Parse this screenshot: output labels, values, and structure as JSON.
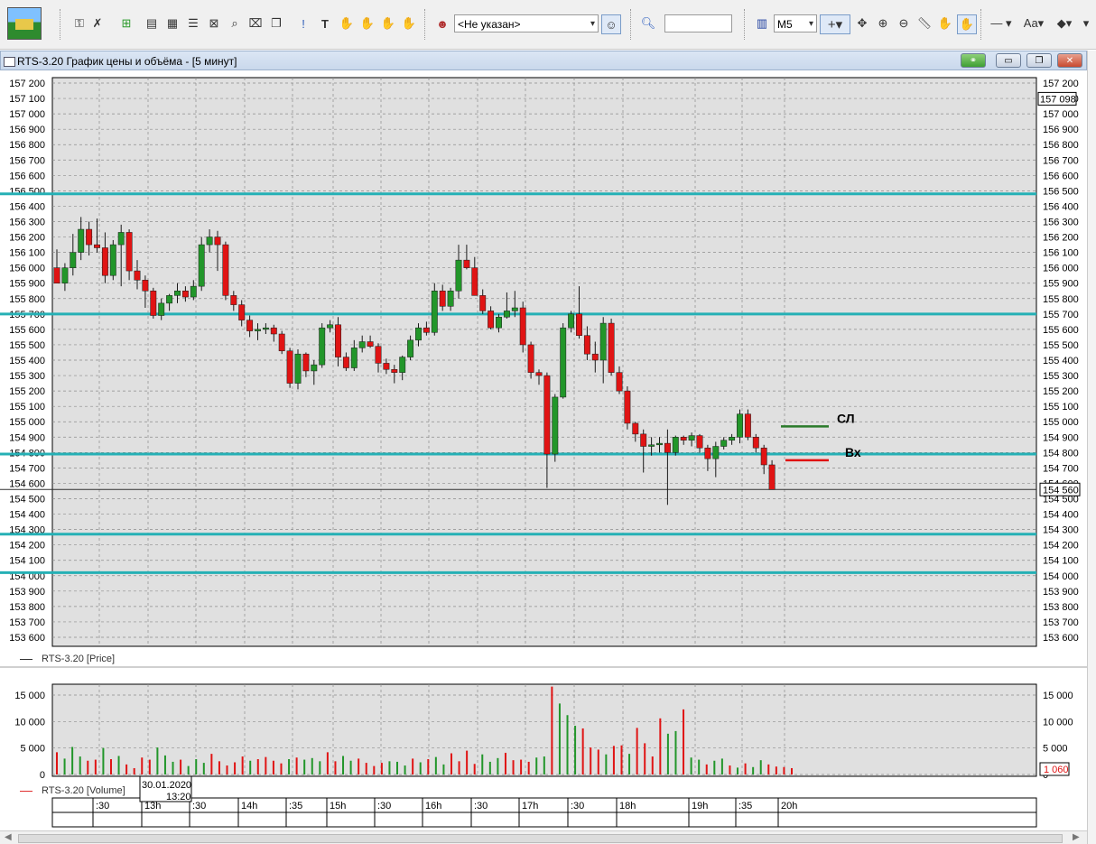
{
  "toolbar": {
    "client_select": "<Не указан>",
    "timeframe_select": "M5",
    "search_value": ""
  },
  "window": {
    "title": "RTS-3.20 График цены и объёма - [5 минут]"
  },
  "price_chart": {
    "legend": "RTS-3.20 [Price]",
    "y_ticks": [
      157200,
      157100,
      157000,
      156900,
      156800,
      156700,
      156600,
      156500,
      156400,
      156300,
      156200,
      156100,
      156000,
      155900,
      155800,
      155700,
      155600,
      155500,
      155400,
      155300,
      155200,
      155100,
      155000,
      154900,
      154800,
      154700,
      154600,
      154500,
      154400,
      154300,
      154200,
      154100,
      154000,
      153900,
      153800,
      153700,
      153600
    ],
    "y_tick_labels": [
      "157 200",
      "157 100",
      "157 000",
      "156 900",
      "156 800",
      "156 700",
      "156 600",
      "156 500",
      "156 400",
      "156 300",
      "156 200",
      "156 100",
      "156 000",
      "155 900",
      "155 800",
      "155 700",
      "155 600",
      "155 500",
      "155 400",
      "155 300",
      "155 200",
      "155 100",
      "155 000",
      "154 900",
      "154 800",
      "154 700",
      "154 600",
      "154 500",
      "154 400",
      "154 300",
      "154 200",
      "154 100",
      "154 000",
      "153 900",
      "153 800",
      "153 700",
      "153 600"
    ],
    "ylim": [
      153560,
      157250
    ],
    "current_high_label": "157 098",
    "current_high_value": 157098,
    "last_price_label": "154 560",
    "last_price_value": 154560,
    "horizontal_levels": [
      156480,
      155700,
      154790,
      154270,
      154020
    ],
    "annotations": [
      {
        "text": "СЛ",
        "price": 154970,
        "color": "#2a7a2a"
      },
      {
        "text": "Вх",
        "price": 154750,
        "color": "#e01010"
      }
    ],
    "colors": {
      "up": "#22962a",
      "down": "#e01414",
      "level": "#25b0b5",
      "bg": "#e0e0e0"
    }
  },
  "chart_data": [
    {
      "type": "candlestick",
      "title": "RTS-3.20 [Price]",
      "candles": [
        {
          "o": 156000,
          "h": 156120,
          "l": 155900,
          "c": 155900
        },
        {
          "o": 155900,
          "h": 156030,
          "l": 155850,
          "c": 156000
        },
        {
          "o": 156000,
          "h": 156220,
          "l": 155950,
          "c": 156100
        },
        {
          "o": 156100,
          "h": 156330,
          "l": 156050,
          "c": 156250
        },
        {
          "o": 156250,
          "h": 156300,
          "l": 156080,
          "c": 156150
        },
        {
          "o": 156150,
          "h": 156320,
          "l": 156100,
          "c": 156130
        },
        {
          "o": 156130,
          "h": 156230,
          "l": 155900,
          "c": 155950
        },
        {
          "o": 155950,
          "h": 156180,
          "l": 155920,
          "c": 156150
        },
        {
          "o": 156150,
          "h": 156280,
          "l": 155880,
          "c": 156230
        },
        {
          "o": 156230,
          "h": 156250,
          "l": 155920,
          "c": 155980
        },
        {
          "o": 155980,
          "h": 156050,
          "l": 155860,
          "c": 155920
        },
        {
          "o": 155920,
          "h": 155950,
          "l": 155740,
          "c": 155850
        },
        {
          "o": 155850,
          "h": 155870,
          "l": 155670,
          "c": 155690
        },
        {
          "o": 155690,
          "h": 155800,
          "l": 155660,
          "c": 155770
        },
        {
          "o": 155770,
          "h": 155830,
          "l": 155720,
          "c": 155820
        },
        {
          "o": 155820,
          "h": 155900,
          "l": 155770,
          "c": 155850
        },
        {
          "o": 155850,
          "h": 155880,
          "l": 155780,
          "c": 155810
        },
        {
          "o": 155810,
          "h": 155920,
          "l": 155790,
          "c": 155880
        },
        {
          "o": 155880,
          "h": 156200,
          "l": 155850,
          "c": 156150
        },
        {
          "o": 156150,
          "h": 156250,
          "l": 156100,
          "c": 156200
        },
        {
          "o": 156200,
          "h": 156240,
          "l": 155980,
          "c": 156150
        },
        {
          "o": 156150,
          "h": 156170,
          "l": 155790,
          "c": 155820
        },
        {
          "o": 155820,
          "h": 155850,
          "l": 155720,
          "c": 155760
        },
        {
          "o": 155760,
          "h": 155790,
          "l": 155620,
          "c": 155660
        },
        {
          "o": 155660,
          "h": 155690,
          "l": 155550,
          "c": 155590
        },
        {
          "o": 155590,
          "h": 155640,
          "l": 155530,
          "c": 155600
        },
        {
          "o": 155600,
          "h": 155640,
          "l": 155570,
          "c": 155610
        },
        {
          "o": 155610,
          "h": 155630,
          "l": 155520,
          "c": 155570
        },
        {
          "o": 155570,
          "h": 155590,
          "l": 155440,
          "c": 155460
        },
        {
          "o": 155460,
          "h": 155480,
          "l": 155220,
          "c": 155250
        },
        {
          "o": 155250,
          "h": 155470,
          "l": 155210,
          "c": 155440
        },
        {
          "o": 155440,
          "h": 155450,
          "l": 155290,
          "c": 155330
        },
        {
          "o": 155330,
          "h": 155400,
          "l": 155240,
          "c": 155370
        },
        {
          "o": 155370,
          "h": 155640,
          "l": 155350,
          "c": 155610
        },
        {
          "o": 155610,
          "h": 155660,
          "l": 155580,
          "c": 155630
        },
        {
          "o": 155630,
          "h": 155680,
          "l": 155360,
          "c": 155420
        },
        {
          "o": 155420,
          "h": 155450,
          "l": 155330,
          "c": 155350
        },
        {
          "o": 155350,
          "h": 155530,
          "l": 155330,
          "c": 155480
        },
        {
          "o": 155480,
          "h": 155560,
          "l": 155450,
          "c": 155520
        },
        {
          "o": 155520,
          "h": 155560,
          "l": 155480,
          "c": 155490
        },
        {
          "o": 155490,
          "h": 155510,
          "l": 155320,
          "c": 155380
        },
        {
          "o": 155380,
          "h": 155410,
          "l": 155310,
          "c": 155340
        },
        {
          "o": 155340,
          "h": 155370,
          "l": 155250,
          "c": 155320
        },
        {
          "o": 155320,
          "h": 155430,
          "l": 155270,
          "c": 155420
        },
        {
          "o": 155420,
          "h": 155560,
          "l": 155400,
          "c": 155530
        },
        {
          "o": 155530,
          "h": 155640,
          "l": 155490,
          "c": 155610
        },
        {
          "o": 155610,
          "h": 155650,
          "l": 155560,
          "c": 155580
        },
        {
          "o": 155580,
          "h": 155900,
          "l": 155560,
          "c": 155850
        },
        {
          "o": 155850,
          "h": 155890,
          "l": 155720,
          "c": 155750
        },
        {
          "o": 155750,
          "h": 155870,
          "l": 155720,
          "c": 155850
        },
        {
          "o": 155850,
          "h": 156150,
          "l": 155800,
          "c": 156050
        },
        {
          "o": 156050,
          "h": 156150,
          "l": 155990,
          "c": 156000
        },
        {
          "o": 156000,
          "h": 156070,
          "l": 155820,
          "c": 155820
        },
        {
          "o": 155820,
          "h": 155860,
          "l": 155700,
          "c": 155720
        },
        {
          "o": 155720,
          "h": 155750,
          "l": 155600,
          "c": 155610
        },
        {
          "o": 155610,
          "h": 155700,
          "l": 155580,
          "c": 155680
        },
        {
          "o": 155680,
          "h": 155840,
          "l": 155670,
          "c": 155720
        },
        {
          "o": 155720,
          "h": 155850,
          "l": 155680,
          "c": 155740
        },
        {
          "o": 155740,
          "h": 155780,
          "l": 155450,
          "c": 155500
        },
        {
          "o": 155500,
          "h": 155520,
          "l": 155280,
          "c": 155320
        },
        {
          "o": 155320,
          "h": 155340,
          "l": 155240,
          "c": 155300
        },
        {
          "o": 155300,
          "h": 155320,
          "l": 154570,
          "c": 154790
        },
        {
          "o": 154790,
          "h": 155180,
          "l": 154740,
          "c": 155160
        },
        {
          "o": 155160,
          "h": 155640,
          "l": 155150,
          "c": 155610
        },
        {
          "o": 155610,
          "h": 155720,
          "l": 155580,
          "c": 155700
        },
        {
          "o": 155700,
          "h": 155880,
          "l": 155540,
          "c": 155560
        },
        {
          "o": 155560,
          "h": 155620,
          "l": 155400,
          "c": 155440
        },
        {
          "o": 155440,
          "h": 155520,
          "l": 155320,
          "c": 155400
        },
        {
          "o": 155400,
          "h": 155680,
          "l": 155250,
          "c": 155640
        },
        {
          "o": 155640,
          "h": 155670,
          "l": 155300,
          "c": 155320
        },
        {
          "o": 155320,
          "h": 155360,
          "l": 155180,
          "c": 155200
        },
        {
          "o": 155200,
          "h": 155230,
          "l": 154950,
          "c": 154990
        },
        {
          "o": 154990,
          "h": 155000,
          "l": 154870,
          "c": 154920
        },
        {
          "o": 154920,
          "h": 154950,
          "l": 154670,
          "c": 154840
        },
        {
          "o": 154840,
          "h": 154900,
          "l": 154780,
          "c": 154850
        },
        {
          "o": 154850,
          "h": 154900,
          "l": 154800,
          "c": 154860
        },
        {
          "o": 154860,
          "h": 154950,
          "l": 154460,
          "c": 154800
        },
        {
          "o": 154800,
          "h": 154910,
          "l": 154780,
          "c": 154900
        },
        {
          "o": 154900,
          "h": 154910,
          "l": 154850,
          "c": 154880
        },
        {
          "o": 154880,
          "h": 154930,
          "l": 154840,
          "c": 154910
        },
        {
          "o": 154910,
          "h": 154920,
          "l": 154800,
          "c": 154830
        },
        {
          "o": 154830,
          "h": 154850,
          "l": 154680,
          "c": 154760
        },
        {
          "o": 154760,
          "h": 154870,
          "l": 154640,
          "c": 154840
        },
        {
          "o": 154840,
          "h": 154900,
          "l": 154820,
          "c": 154880
        },
        {
          "o": 154880,
          "h": 154920,
          "l": 154850,
          "c": 154900
        },
        {
          "o": 154900,
          "h": 155080,
          "l": 154860,
          "c": 155050
        },
        {
          "o": 155050,
          "h": 155080,
          "l": 154880,
          "c": 154900
        },
        {
          "o": 154900,
          "h": 154920,
          "l": 154800,
          "c": 154830
        },
        {
          "o": 154830,
          "h": 154850,
          "l": 154660,
          "c": 154720
        },
        {
          "o": 154720,
          "h": 154750,
          "l": 154560,
          "c": 154560
        }
      ]
    },
    {
      "type": "bar",
      "title": "RTS-3.20 [Volume]",
      "ylim": [
        0,
        17000
      ],
      "y_ticks": [
        0,
        5000,
        10000,
        15000
      ],
      "y_tick_labels": [
        "0",
        "5 000",
        "10 000",
        "15 000"
      ],
      "last_label": "1 060",
      "values": [
        4200,
        3000,
        5200,
        3400,
        2600,
        2800,
        5000,
        2900,
        3500,
        1900,
        1200,
        3200,
        2800,
        5100,
        3600,
        2400,
        2800,
        1600,
        2900,
        2200,
        3900,
        2500,
        1700,
        2300,
        3400,
        2600,
        2900,
        3300,
        2600,
        2100,
        2900,
        3200,
        2800,
        3100,
        2500,
        4200,
        2500,
        3500,
        2600,
        3000,
        2200,
        1600,
        2200,
        2500,
        2400,
        1700,
        3000,
        2300,
        2900,
        3300,
        1900,
        4000,
        2500,
        4500,
        2000,
        3800,
        2400,
        3100,
        4100,
        2700,
        2800,
        2400,
        3200,
        3400,
        16600,
        13400,
        11200,
        9200,
        8700,
        5100,
        4700,
        3800,
        5400,
        5500,
        3900,
        8800,
        5900,
        3400,
        10600,
        7700,
        8200,
        12300,
        3200,
        2800,
        1900,
        2600,
        3000,
        1700,
        1300,
        2100,
        1400,
        2700,
        1900,
        1500,
        1400,
        1200
      ],
      "up_flags": [
        0,
        1,
        1,
        1,
        0,
        0,
        1,
        0,
        1,
        0,
        0,
        0,
        0,
        1,
        1,
        1,
        0,
        1,
        1,
        1,
        0,
        0,
        0,
        0,
        0,
        1,
        0,
        0,
        0,
        0,
        1,
        0,
        1,
        1,
        1,
        0,
        0,
        1,
        1,
        0,
        0,
        0,
        0,
        1,
        1,
        1,
        0,
        1,
        0,
        1,
        1,
        0,
        0,
        0,
        0,
        1,
        1,
        1,
        0,
        0,
        0,
        0,
        1,
        1,
        0,
        1,
        1,
        1,
        0,
        0,
        0,
        1,
        0,
        0,
        1,
        0,
        0,
        0,
        0,
        1,
        1,
        0,
        1,
        1,
        0,
        1,
        1,
        0,
        1,
        0,
        1,
        1,
        0,
        0,
        0,
        0
      ]
    }
  ],
  "time_axis": {
    "labels": [
      ":30",
      "13h",
      ":30",
      "14h",
      ":35",
      "15h",
      ":30",
      "16h",
      ":30",
      "17h",
      ":30",
      "18h",
      "19h",
      ":35",
      "20h"
    ],
    "tooltip_date": "30.01.2020",
    "tooltip_time": "13:20"
  }
}
